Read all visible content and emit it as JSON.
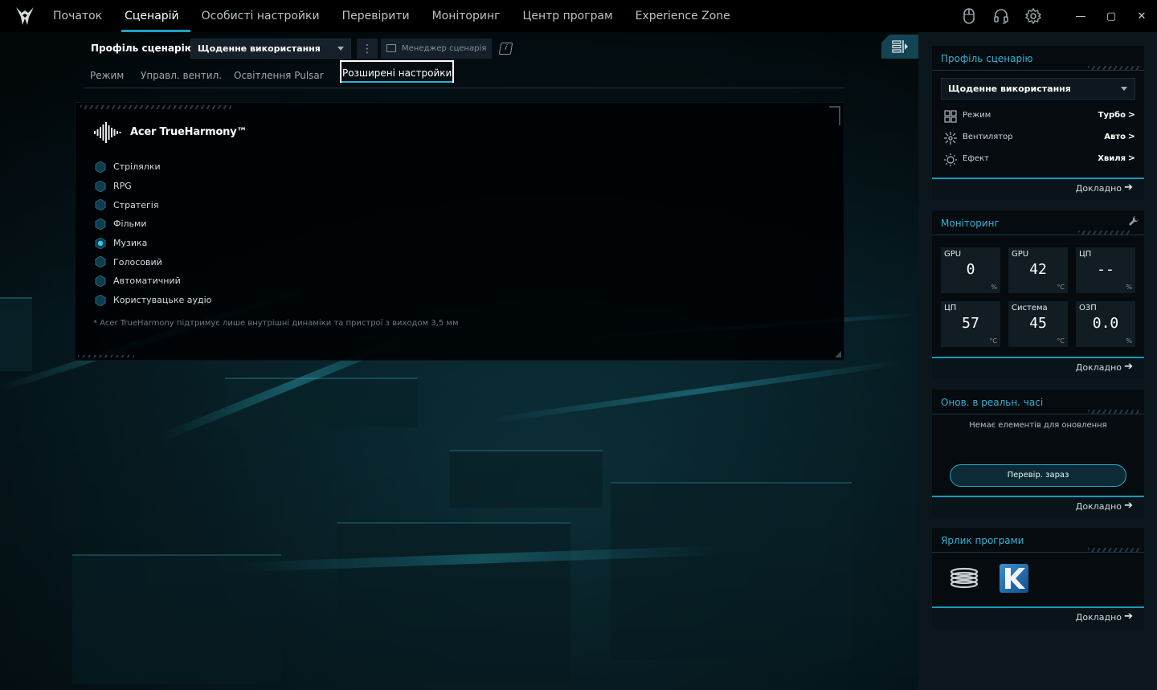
{
  "nav": {
    "items": [
      "Початок",
      "Сценарій",
      "Особисті настройки",
      "Перевірити",
      "Моніторинг",
      "Центр програм",
      "Experience Zone"
    ],
    "active_index": 1
  },
  "window_controls": [
    "—",
    "▢",
    "✕"
  ],
  "scenario": {
    "label": "Профіль сценарію",
    "selected": "Щоденне використання",
    "manager_label": "Менеджер сценарія",
    "info_label": "i"
  },
  "subtabs": [
    "Режим",
    "Управл. вентил.",
    "Освітлення Pulsar",
    "Розширені настройки"
  ],
  "subtabs_active_index": 3,
  "trueharmony": {
    "title": "Acer TrueHarmony™",
    "options": [
      "Стрілялки",
      "RPG",
      "Стратегія",
      "Фільми",
      "Музика",
      "Голосовий",
      "Автоматичний",
      "Користувацьке аудіо"
    ],
    "selected_index": 4,
    "footnote": "* Acer TrueHarmony підтримує лише внутрішні динаміки та пристрої з виходом 3,5 мм"
  },
  "sidebar": {
    "more_label": "Докладно",
    "profile": {
      "title": "Профіль сценарію",
      "selected": "Щоденне використання",
      "rows": [
        {
          "label": "Режим",
          "value": "Турбо",
          "icon": "grid-icon"
        },
        {
          "label": "Вентилятор",
          "value": "Авто",
          "icon": "fan-icon"
        },
        {
          "label": "Ефект",
          "value": "Хвиля",
          "icon": "sun-icon"
        }
      ]
    },
    "monitoring": {
      "title": "Моніторинг",
      "tiles": [
        {
          "label": "GPU",
          "value": "0",
          "unit": "%"
        },
        {
          "label": "GPU",
          "value": "42",
          "unit": "°C"
        },
        {
          "label": "ЦП",
          "value": "--",
          "unit": "%"
        },
        {
          "label": "ЦП",
          "value": "57",
          "unit": "°C"
        },
        {
          "label": "Система",
          "value": "45",
          "unit": "°C"
        },
        {
          "label": "ОЗП",
          "value": "0.0",
          "unit": "%"
        }
      ]
    },
    "updates": {
      "title": "Онов. в реальн. часі",
      "empty_text": "Немає елементів для оновлення",
      "check_button": "Перевір. зараз"
    },
    "shortcuts": {
      "title": "Ярлик програми",
      "apps": [
        "coil-app-icon",
        "k-app-icon"
      ]
    }
  },
  "colors": {
    "accent": "#2fb4d4",
    "accent_dark": "#169ab8",
    "background": "#03080b"
  }
}
